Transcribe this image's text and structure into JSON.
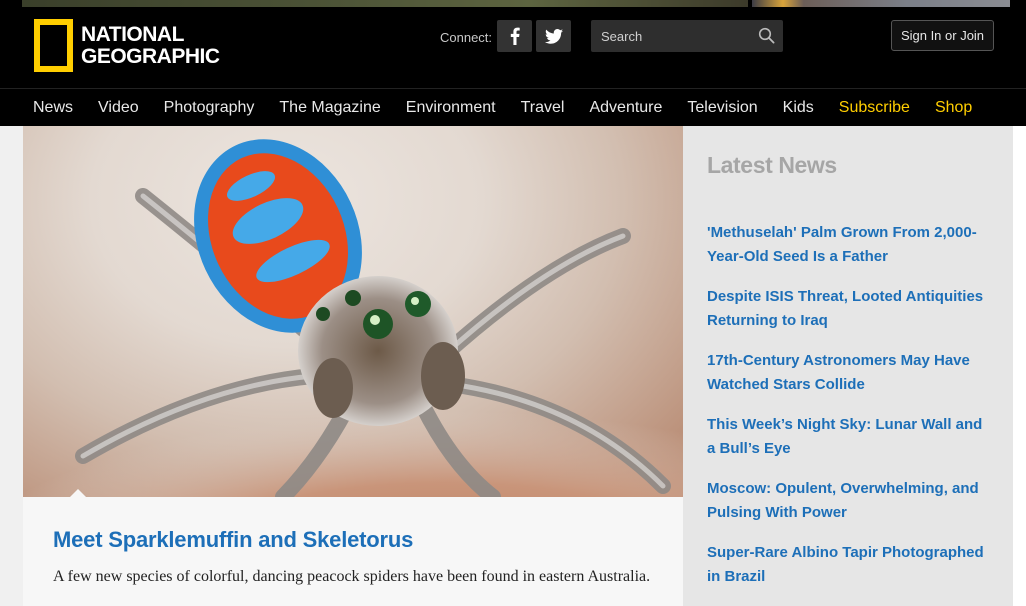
{
  "header": {
    "logo_line1": "NATIONAL",
    "logo_line2": "GEOGRAPHIC",
    "connect_label": "Connect:",
    "search_placeholder": "Search",
    "signin_label": "Sign In or Join",
    "icons": [
      "facebook-icon",
      "twitter-icon",
      "search-icon"
    ]
  },
  "nav": {
    "items": [
      "News",
      "Video",
      "Photography",
      "The Magazine",
      "Environment",
      "Travel",
      "Adventure",
      "Television",
      "Kids",
      "Subscribe",
      "Shop"
    ]
  },
  "hero": {
    "headline": "Meet Sparklemuffin and Skeletorus",
    "dek": "A few new species of colorful, dancing peacock spiders have been found in eastern Australia."
  },
  "sidebar": {
    "title": "Latest News",
    "items": [
      "'Methuselah' Palm Grown From 2,000-Year-Old Seed Is a Father",
      "Despite ISIS Threat, Looted Antiquities Returning to Iraq",
      "17th-Century Astronomers May Have Watched Stars Collide",
      "This Week’s Night Sky: Lunar Wall and a Bull’s Eye",
      "Moscow: Opulent, Overwhelming, and Pulsing With Power",
      "Super-Rare Albino Tapir Photographed in Brazil"
    ]
  },
  "colors": {
    "brand_yellow": "#ffce00",
    "link_blue": "#1d6fb8",
    "header_bg": "#000000"
  }
}
